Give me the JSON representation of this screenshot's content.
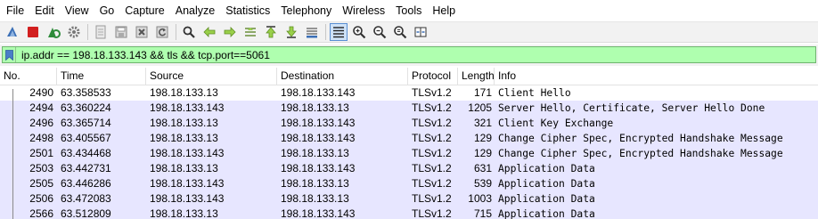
{
  "menu": [
    "File",
    "Edit",
    "View",
    "Go",
    "Capture",
    "Analyze",
    "Statistics",
    "Telephony",
    "Wireless",
    "Tools",
    "Help"
  ],
  "toolbar": {
    "icons": [
      "shark-fin-start-icon",
      "stop-square-icon",
      "restart-capture-icon",
      "capture-options-gear-icon",
      "open-file-icon",
      "save-file-icon",
      "close-file-icon",
      "reload-icon",
      "find-packet-icon",
      "go-back-icon",
      "go-forward-icon",
      "go-to-packet-icon",
      "go-first-packet-icon",
      "go-last-packet-icon",
      "auto-scroll-icon",
      "colorize-icon",
      "zoom-in-icon",
      "zoom-out-icon",
      "normal-size-icon",
      "resize-columns-icon"
    ],
    "active_icon": "colorize-icon"
  },
  "filter": {
    "text": "ip.addr == 198.18.133.143 && tls && tcp.port==5061",
    "bg_color": "#afffaf"
  },
  "columns": [
    "No.",
    "Time",
    "Source",
    "Destination",
    "Protocol",
    "Length",
    "Info"
  ],
  "rows": [
    {
      "no": "2490",
      "time": "63.358533",
      "src": "198.18.133.13",
      "dst": "198.18.133.143",
      "proto": "TLSv1.2",
      "len": "171",
      "info": "Client Hello"
    },
    {
      "no": "2494",
      "time": "63.360224",
      "src": "198.18.133.143",
      "dst": "198.18.133.13",
      "proto": "TLSv1.2",
      "len": "1205",
      "info": "Server Hello, Certificate, Server Hello Done"
    },
    {
      "no": "2496",
      "time": "63.365714",
      "src": "198.18.133.13",
      "dst": "198.18.133.143",
      "proto": "TLSv1.2",
      "len": "321",
      "info": "Client Key Exchange"
    },
    {
      "no": "2498",
      "time": "63.405567",
      "src": "198.18.133.13",
      "dst": "198.18.133.143",
      "proto": "TLSv1.2",
      "len": "129",
      "info": "Change Cipher Spec, Encrypted Handshake Message"
    },
    {
      "no": "2501",
      "time": "63.434468",
      "src": "198.18.133.143",
      "dst": "198.18.133.13",
      "proto": "TLSv1.2",
      "len": "129",
      "info": "Change Cipher Spec, Encrypted Handshake Message"
    },
    {
      "no": "2503",
      "time": "63.442731",
      "src": "198.18.133.13",
      "dst": "198.18.133.143",
      "proto": "TLSv1.2",
      "len": "631",
      "info": "Application Data"
    },
    {
      "no": "2505",
      "time": "63.446286",
      "src": "198.18.133.143",
      "dst": "198.18.133.13",
      "proto": "TLSv1.2",
      "len": "539",
      "info": "Application Data"
    },
    {
      "no": "2506",
      "time": "63.472083",
      "src": "198.18.133.143",
      "dst": "198.18.133.13",
      "proto": "TLSv1.2",
      "len": "1003",
      "info": "Application Data"
    },
    {
      "no": "2566",
      "time": "63.512809",
      "src": "198.18.133.13",
      "dst": "198.18.133.143",
      "proto": "TLSv1.2",
      "len": "715",
      "info": "Application Data"
    }
  ],
  "row_colors": [
    "#ffffff",
    "#e7e6ff"
  ]
}
